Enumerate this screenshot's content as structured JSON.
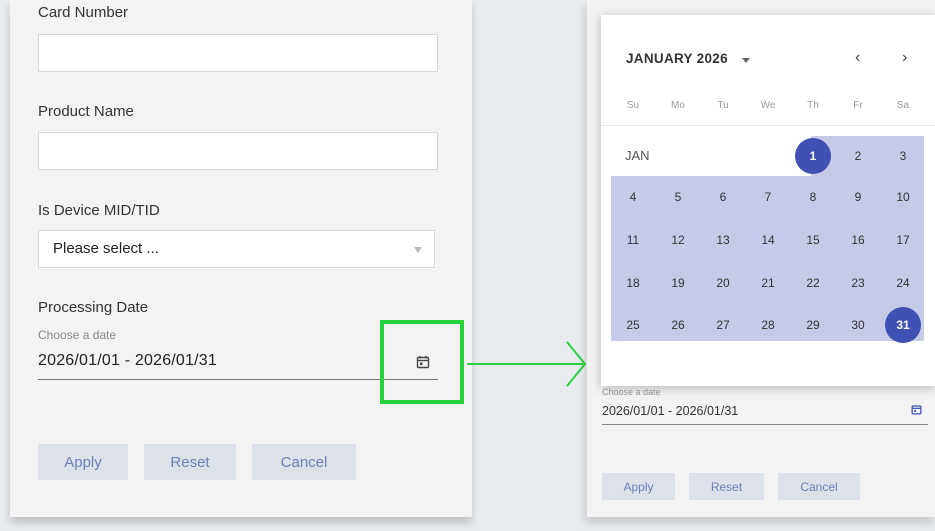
{
  "form": {
    "card_number_label": "Card Number",
    "product_name_label": "Product Name",
    "device_label": "Is Device MID/TID",
    "device_select_value": "Please select ...",
    "processing_date_label": "Processing Date",
    "date_hint": "Choose a date",
    "date_value": "2026/01/01 - 2026/01/31",
    "apply_label": "Apply",
    "reset_label": "Reset",
    "cancel_label": "Cancel"
  },
  "calendar": {
    "month_title": "JANUARY 2026",
    "month_label": "JAN",
    "prev": "‹",
    "next": "›",
    "weekdays": [
      "Su",
      "Mo",
      "Tu",
      "We",
      "Th",
      "Fr",
      "Sa"
    ],
    "days": [
      "1",
      "2",
      "3",
      "4",
      "5",
      "6",
      "7",
      "8",
      "9",
      "10",
      "11",
      "12",
      "13",
      "14",
      "15",
      "16",
      "17",
      "18",
      "19",
      "20",
      "21",
      "22",
      "23",
      "24",
      "25",
      "26",
      "27",
      "28",
      "29",
      "30",
      "31"
    ],
    "range_start": "1",
    "range_end": "31"
  },
  "colors": {
    "accent": "#3f51b5",
    "range": "#c5cae9",
    "highlight": "#27d33a"
  }
}
